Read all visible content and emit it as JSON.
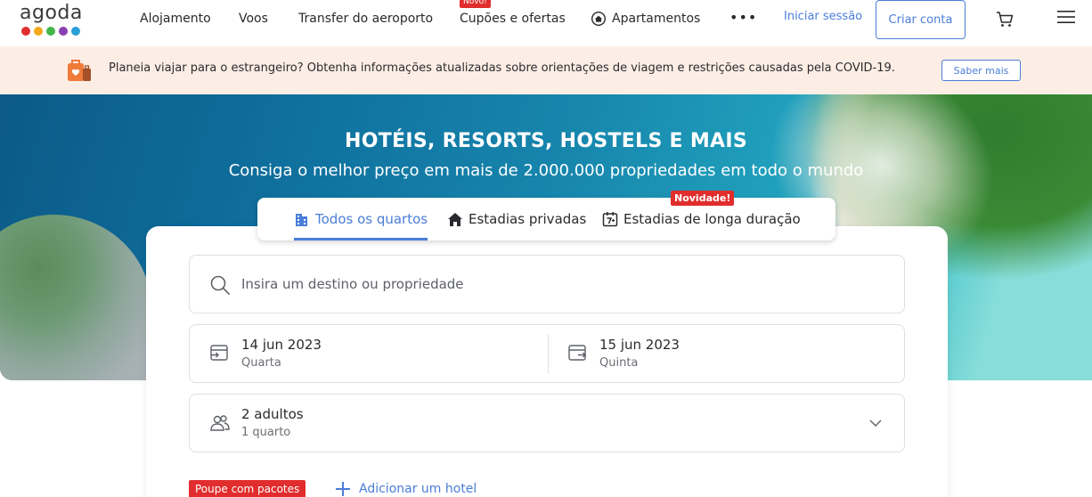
{
  "header": {
    "logo_text": "agoda",
    "logo_dot_colors": [
      "#e12d2d",
      "#f4a81d",
      "#43b649",
      "#8a3fb3",
      "#2a9fd8"
    ],
    "nav": {
      "accommodation": "Alojamento",
      "flights": "Voos",
      "airport_transfer": "Transfer do aeroporto",
      "coupons": "Cupões e ofertas",
      "coupons_badge": "Novo!",
      "apartments": "Apartamentos",
      "more": "•••"
    },
    "signin": "Iniciar sessão",
    "create_account": "Criar conta"
  },
  "covid_banner": {
    "text": "Planeia viajar para o estrangeiro? Obtenha informações atualizadas sobre orientações de viagem e restrições causadas pela COVID-19.",
    "button": "Saber mais"
  },
  "hero": {
    "title": "HOTÉIS, RESORTS, HOSTELS E MAIS",
    "subtitle": "Consiga o melhor preço em mais de 2.000.000 propriedades em todo o mundo"
  },
  "tabs": {
    "all_rooms": "Todos os quartos",
    "private_stays": "Estadias privadas",
    "long_stays": "Estadias de longa duração",
    "long_stays_badge": "Novidade!"
  },
  "search": {
    "placeholder": "Insira um destino ou propriedade",
    "checkin": {
      "date": "14 jun 2023",
      "weekday": "Quarta"
    },
    "checkout": {
      "date": "15 jun 2023",
      "weekday": "Quinta"
    },
    "guests": {
      "adults": "2 adultos",
      "rooms": "1 quarto"
    },
    "package_badge": "Poupe com pacotes",
    "add_hotel": "Adicionar um hotel"
  },
  "colors": {
    "accent": "#4a7ed9",
    "badge_red": "#e12d2d",
    "banner_bg": "#fdeee5"
  }
}
